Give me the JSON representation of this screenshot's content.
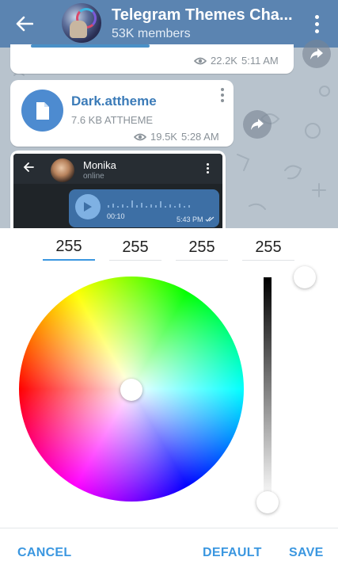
{
  "header": {
    "title": "Telegram Themes Cha...",
    "subtitle": "53K members"
  },
  "messages": [
    {
      "views": "22.2K",
      "time": "5:11 AM"
    },
    {
      "file_name": "Dark.attheme",
      "file_info": "7.6 KB ATTHEME",
      "views": "19.5K",
      "time": "5:28 AM"
    }
  ],
  "preview": {
    "contact_name": "Monika",
    "contact_status": "online",
    "voice_duration": "00:10",
    "voice_time": "5:43 PM"
  },
  "color_picker": {
    "values": [
      "255",
      "255",
      "255",
      "255"
    ],
    "selected_color": "#ffffff"
  },
  "actions": {
    "cancel": "CANCEL",
    "default": "DEFAULT",
    "save": "SAVE"
  },
  "colors": {
    "header": "#5b84b1",
    "accent": "#3b97e0",
    "link": "#3b7bb8"
  },
  "icons": [
    "back-arrow-icon",
    "more-vert-icon",
    "eye-icon",
    "share-icon",
    "file-icon",
    "play-icon",
    "double-check-icon"
  ]
}
